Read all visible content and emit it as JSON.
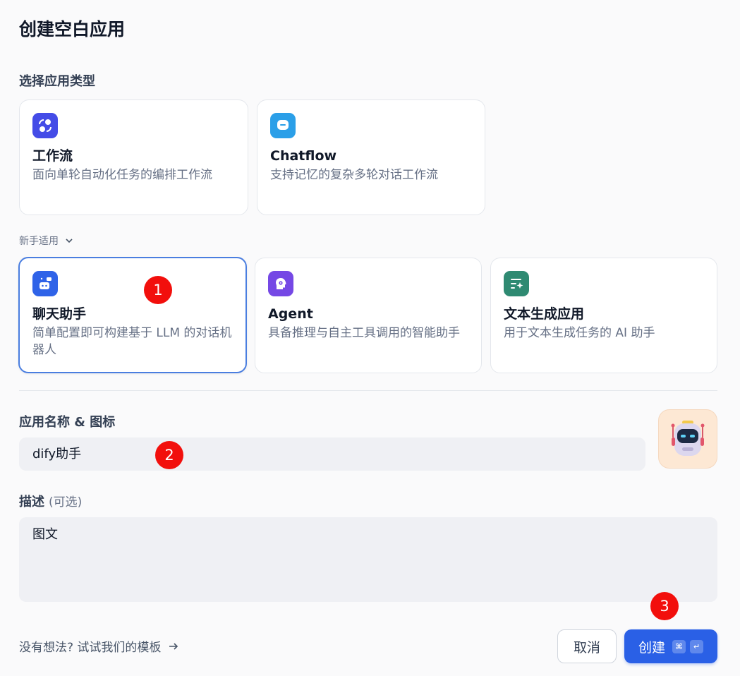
{
  "page": {
    "title": "创建空白应用",
    "type_section_label": "选择应用类型",
    "beginner_toggle": "新手适用",
    "name_section_label": "应用名称 & 图标",
    "desc_section_label": "描述",
    "desc_optional": "(可选)",
    "template_link": "没有想法? 试试我们的模板"
  },
  "app_types": [
    {
      "title": "工作流",
      "desc": "面向单轮自动化任务的编排工作流",
      "icon": "workflow-icon",
      "color": "#444ce7"
    },
    {
      "title": "Chatflow",
      "desc": "支持记忆的复杂多轮对话工作流",
      "icon": "chatflow-icon",
      "color": "#2b9fe8"
    }
  ],
  "beginner_types": [
    {
      "title": "聊天助手",
      "desc": "简单配置即可构建基于 LLM 的对话机器人",
      "icon": "chatbot-icon",
      "color": "#2f63e8",
      "selected": true
    },
    {
      "title": "Agent",
      "desc": "具备推理与自主工具调用的智能助手",
      "icon": "agent-icon",
      "color": "#7548e5",
      "selected": false
    },
    {
      "title": "文本生成应用",
      "desc": "用于文本生成任务的 AI 助手",
      "icon": "text-generation-icon",
      "color": "#2f8a72",
      "selected": false
    }
  ],
  "form": {
    "name_value": "dify助手",
    "desc_value": "图文",
    "avatar_icon": "robot-avatar-icon"
  },
  "buttons": {
    "cancel": "取消",
    "create": "创建",
    "shortcut_cmd": "⌘",
    "shortcut_enter": "↵"
  },
  "annotations": [
    "1",
    "2",
    "3"
  ],
  "colors": {
    "primary": "#2a60e6",
    "selected_border": "#4a7ee0",
    "annotation_red": "#f20f0c"
  }
}
